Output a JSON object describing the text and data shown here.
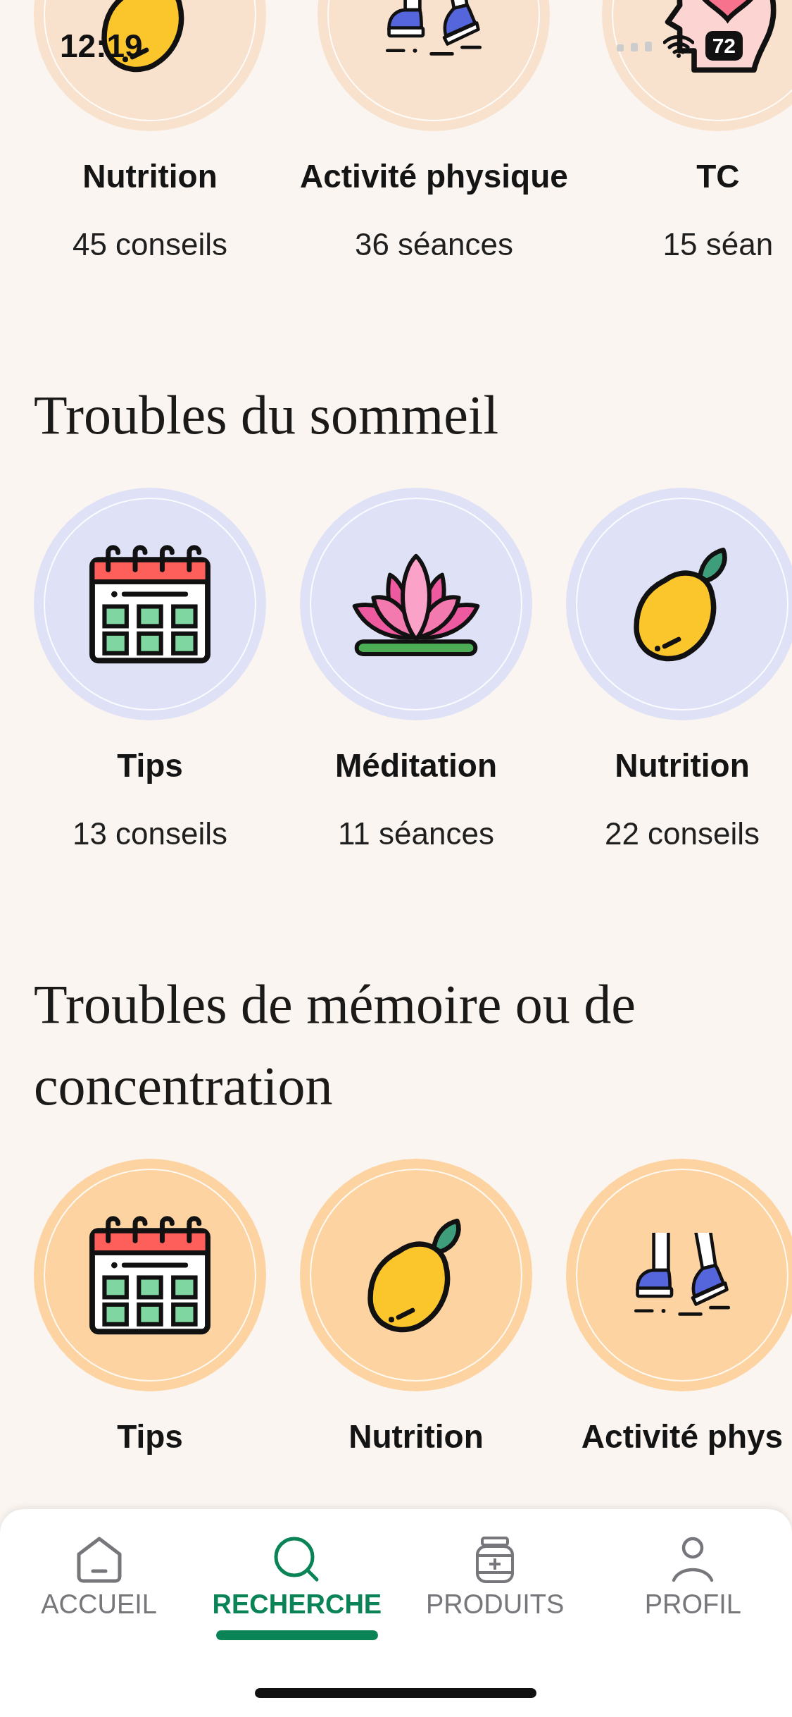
{
  "status_bar": {
    "time": "12:19",
    "battery": "72"
  },
  "sections": [
    {
      "color": "#f8e2cd",
      "items": [
        {
          "kind": "nutrition",
          "title": "Nutrition",
          "count": "45 conseils"
        },
        {
          "kind": "activity",
          "title": "Activité physique",
          "count": "36 séances"
        },
        {
          "kind": "tcc",
          "title": "TC",
          "count": "15 séan"
        }
      ]
    },
    {
      "title": "Troubles du sommeil",
      "color": "#dfe1f7",
      "items": [
        {
          "kind": "tips",
          "title": "Tips",
          "count": "13 conseils"
        },
        {
          "kind": "meditation",
          "title": "Méditation",
          "count": "11 séances"
        },
        {
          "kind": "nutrition",
          "title": "Nutrition",
          "count": "22 conseils"
        }
      ]
    },
    {
      "title": "Troubles de mémoire ou de concentration",
      "color": "#fdd3a1",
      "items": [
        {
          "kind": "tips",
          "title": "Tips"
        },
        {
          "kind": "nutrition",
          "title": "Nutrition"
        },
        {
          "kind": "activity",
          "title": "Activité phys"
        }
      ]
    }
  ],
  "nav": [
    {
      "kind": "home",
      "label": "ACCUEIL",
      "selected": false
    },
    {
      "kind": "search",
      "label": "RECHERCHE",
      "selected": true
    },
    {
      "kind": "products",
      "label": "PRODUITS",
      "selected": false
    },
    {
      "kind": "profile",
      "label": "PROFIL",
      "selected": false
    }
  ]
}
